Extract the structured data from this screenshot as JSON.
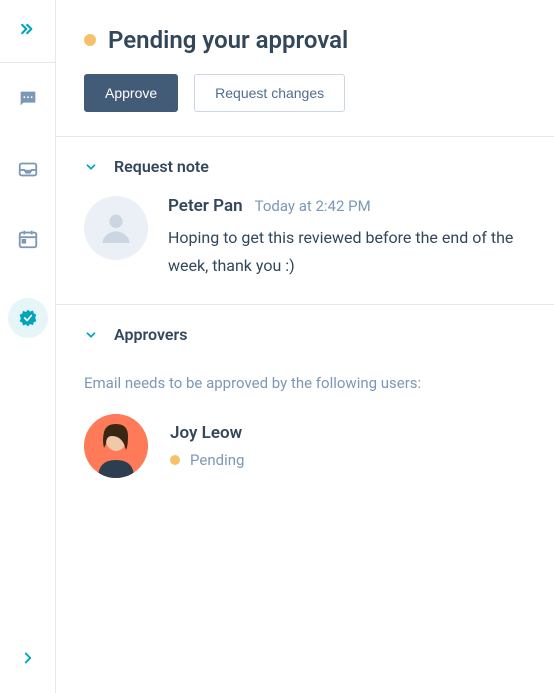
{
  "header": {
    "title": "Pending your approval",
    "status_color": "#f5c26b",
    "approve_label": "Approve",
    "request_changes_label": "Request changes"
  },
  "request_note": {
    "section_title": "Request note",
    "author": "Peter Pan",
    "timestamp": "Today at 2:42 PM",
    "message": "Hoping to get this reviewed before the end of the week, thank you :)"
  },
  "approvers": {
    "section_title": "Approvers",
    "description": "Email needs to be approved by the following users:",
    "list": [
      {
        "name": "Joy Leow",
        "status": "Pending",
        "status_color": "#f5c26b"
      }
    ]
  },
  "sidebar": {
    "items": [
      {
        "icon": "collapse",
        "active": false
      },
      {
        "icon": "chat",
        "active": false
      },
      {
        "icon": "inbox",
        "active": false
      },
      {
        "icon": "calendar",
        "active": false
      },
      {
        "icon": "approval",
        "active": true
      }
    ],
    "bottom_icon": "expand"
  }
}
